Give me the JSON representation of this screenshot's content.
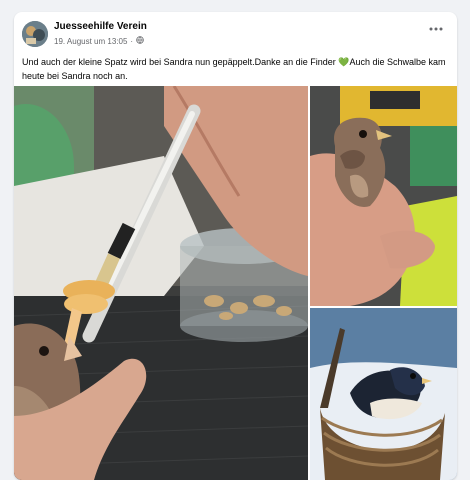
{
  "post": {
    "author": "Juesseehilfe Verein",
    "date": "19. August um 13:05",
    "privacy_icon": "globe-icon",
    "more_icon": "more-horizontal-icon",
    "text_part1": "Und auch der kleine Spatz wird bei Sandra nun gepäppelt.Danke an die Finder ",
    "text_emoji": "💚",
    "text_part2": "Auch die Schwalbe kam heute bei Sandra noch an."
  },
  "colors": {
    "background": "#f0f2f5",
    "card": "#ffffff",
    "name": "#050505",
    "meta": "#65676b",
    "heart": "#5fb845"
  },
  "photos": [
    {
      "subject": "syringe-feeding-sparrow-photo"
    },
    {
      "subject": "sparrow-in-hand-photo"
    },
    {
      "subject": "swallow-in-basket-photo"
    }
  ]
}
